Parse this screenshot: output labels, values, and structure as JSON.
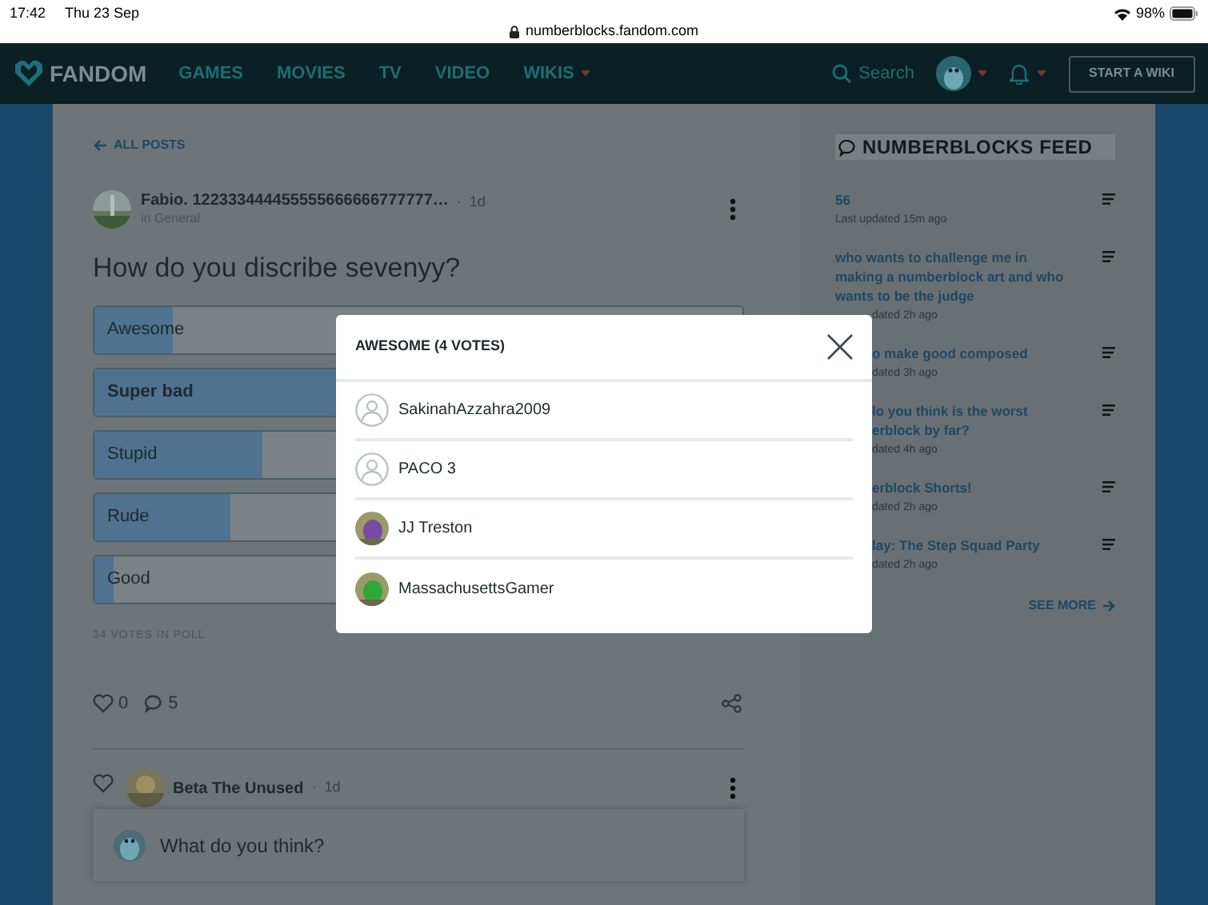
{
  "status_bar": {
    "time": "17:42",
    "date": "Thu 23 Sep",
    "url": "numberblocks.fandom.com",
    "battery": "98%"
  },
  "nav": {
    "logo": "FANDOM",
    "links": [
      {
        "label": "GAMES",
        "dropdown": false
      },
      {
        "label": "MOVIES",
        "dropdown": false
      },
      {
        "label": "TV",
        "dropdown": false
      },
      {
        "label": "VIDEO",
        "dropdown": false
      },
      {
        "label": "WIKIS",
        "dropdown": true
      }
    ],
    "search": "Search",
    "button": "START A WIKI"
  },
  "post": {
    "back": "ALL POSTS",
    "author": "Fabio. 122333444455555666666777777…",
    "separator": "·",
    "age": "1d",
    "category": "in General",
    "title": "How do you discribe sevenyy?",
    "options": [
      {
        "label": "Awesome",
        "level": 0.12,
        "selected": false
      },
      {
        "label": "Super bad",
        "level": 0.38,
        "selected": true
      },
      {
        "label": "Stupid",
        "level": 0.26,
        "selected": false
      },
      {
        "label": "Rude",
        "level": 0.21,
        "selected": false
      },
      {
        "label": "Good",
        "level": 0.03,
        "selected": false
      }
    ],
    "votes_total": "34 VOTES IN POLL",
    "likes": "0",
    "comments": "5"
  },
  "reply": {
    "author": "Beta The Unused",
    "separator": "·",
    "age": "1d"
  },
  "composer": {
    "placeholder": "What do you think?"
  },
  "feed": {
    "title": "NUMBERBLOCKS FEED",
    "items": [
      {
        "title": "56",
        "meta": "Last updated 15m ago"
      },
      {
        "title": "who wants to challenge me in making a numberblock art and who wants to be the judge",
        "meta": "dated 2h ago",
        "title_cut": false,
        "meta_cut": true
      },
      {
        "title": "o make good composed",
        "meta": "dated 3h ago",
        "title_cut": true,
        "meta_cut": true
      },
      {
        "title": "lo you think is the worst\nerblock by far?",
        "meta": "dated 4h ago",
        "title_cut": true,
        "meta_cut": true
      },
      {
        "title": "erblock Shorts!",
        "meta": "dated 2h ago",
        "title_cut": true,
        "meta_cut": true
      },
      {
        "title": "lay: The Step Squad Party",
        "meta": "dated 2h ago",
        "title_cut": true,
        "meta_cut": true
      }
    ],
    "see_more": "SEE MORE"
  },
  "modal": {
    "title": "AWESOME (4 VOTES)",
    "voters": [
      {
        "name": "SakinahAzzahra2009",
        "kind": "default"
      },
      {
        "name": "PACO 3",
        "kind": "default"
      },
      {
        "name": "JJ Treston",
        "kind": "picture",
        "color": "#7a4aa0"
      },
      {
        "name": "MassachusettsGamer",
        "kind": "picture",
        "color": "#2fa83a"
      }
    ]
  }
}
